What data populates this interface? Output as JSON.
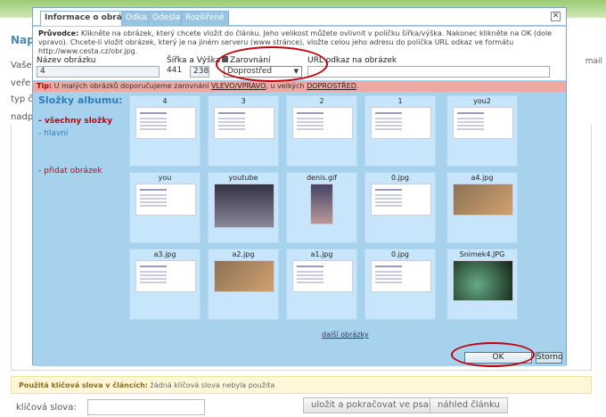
{
  "background": {
    "title": "Nap",
    "lines": [
      "Vaše",
      "veře",
      "typ č",
      "nadp"
    ],
    "right_snippet": "mail",
    "keywords_bar": {
      "label": "Použitá klíčová slova v článcích:",
      "value": "žádná klíčová slova nebyla použita"
    },
    "keyword_label": "klíčová slova:",
    "btn_save": "uložit a pokračovat ve psaní",
    "btn_preview": "náhled článku"
  },
  "dialog": {
    "tabs": [
      {
        "label": "Informace o obrázku",
        "active": true
      },
      {
        "label": "Odkaz",
        "active": false
      },
      {
        "label": "Odeslat",
        "active": false
      },
      {
        "label": "Rozšířené",
        "active": false
      }
    ],
    "close_glyph": "✕",
    "guide_label": "Průvodce:",
    "guide_text": "Klikněte na obrázek, který chcete vložit do článku. Jeho velikost můžete ovlivnit v políčku šířka/výška. Nakonec klikněte na OK (dole vpravo). Chcete-li vložit obrázek, který je na jiném serveru (www stránce), vložte celou jeho adresu do políčka URL odkaz ve formátu http://www.cesta.cz/obr.jpg.",
    "fields": {
      "name_label": "Název obrázku",
      "name_value": "4",
      "size_label": "Šířka a Výška",
      "width": "441",
      "height": "238",
      "align_label": "Zarovnání",
      "align_value": "Doprostřed",
      "url_label": "URL odkaz na obrázek",
      "url_value": ""
    },
    "tip_label": "Tip:",
    "tip_text_1": "U malých obrázků doporučujeme zarovnání",
    "tip_link_1": "VLEVO/VPRAVO",
    "tip_text_2": ", u velkých",
    "tip_link_2": "DOPROSTŘED",
    "tip_end": ".",
    "sidebar": {
      "title": "Složky albumu:",
      "all": "- všechny složky",
      "main": "- hlavní",
      "add": "- přidat obrázek"
    },
    "thumbnails": [
      "4",
      "3",
      "2",
      "1",
      "you2",
      "you",
      "youtube",
      "denis.gif",
      "0.jpg",
      "a4.jpg",
      "a3.jpg",
      "a2.jpg",
      "a1.jpg",
      "0.jpg",
      "Snimek4.JPG"
    ],
    "more_link": "další obrázky",
    "ok": "OK",
    "storno": "Storno"
  }
}
